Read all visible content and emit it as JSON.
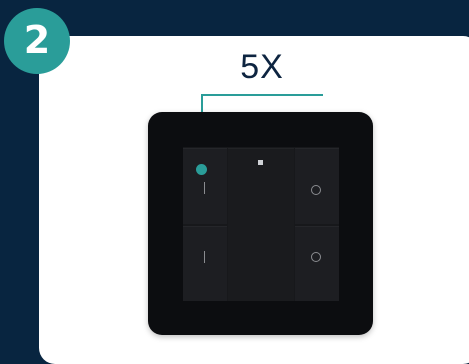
{
  "step": {
    "number": "2"
  },
  "callout": {
    "text": "5X"
  },
  "colors": {
    "background": "#082540",
    "card": "#ffffff",
    "accent": "#2a9d99",
    "switch_frame": "#0c0d10",
    "switch_button": "#1d1e22"
  },
  "switch": {
    "buttons": [
      {
        "position": "top-left",
        "icon": "bar-icon"
      },
      {
        "position": "bottom-left",
        "icon": "bar-icon"
      },
      {
        "position": "center",
        "icon": "indicator-led"
      },
      {
        "position": "top-right",
        "icon": "circle-icon"
      },
      {
        "position": "bottom-right",
        "icon": "circle-icon"
      }
    ]
  }
}
